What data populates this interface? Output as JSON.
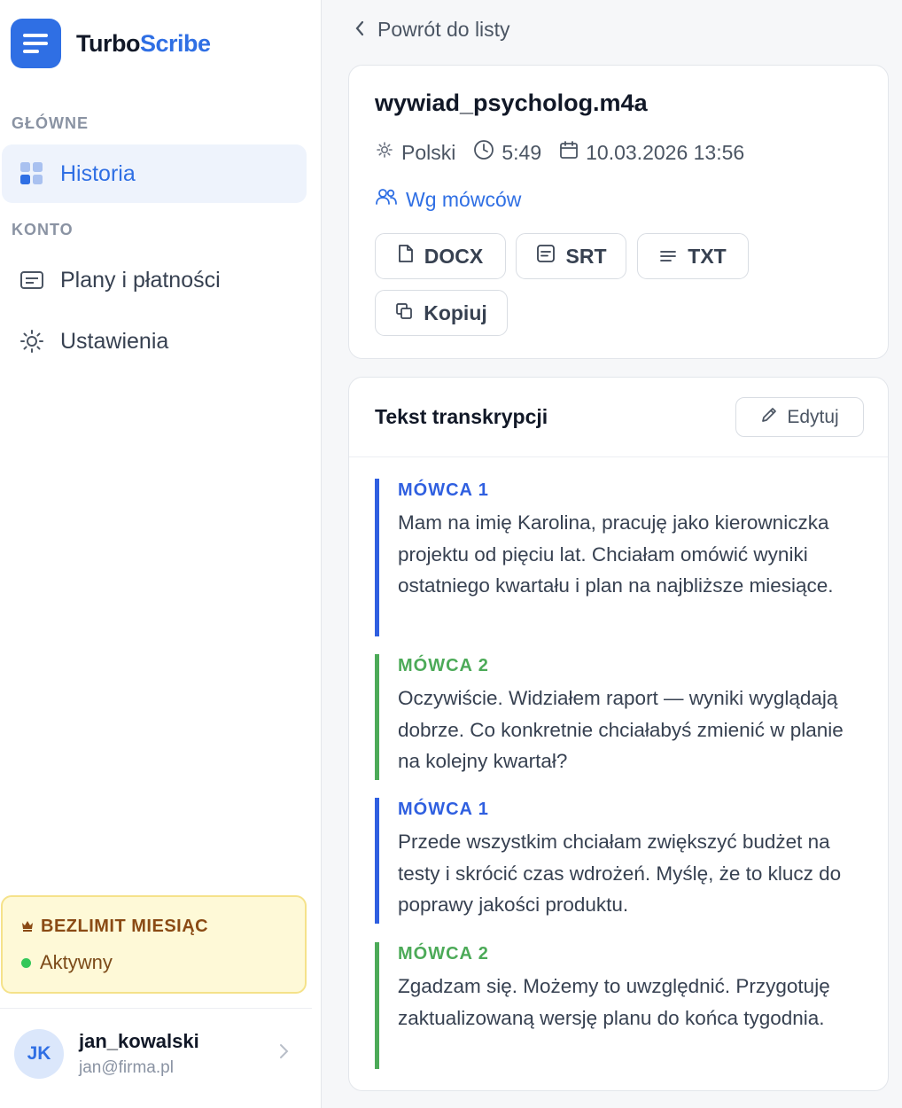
{
  "brand": {
    "name_part1": "Turbo",
    "name_part2": "Scribe"
  },
  "sidebar": {
    "section_main": "GŁÓWNE",
    "section_account": "KONTO",
    "items": [
      {
        "label": "Historia",
        "icon": "grid-icon",
        "active": true
      },
      {
        "label": "Plany i płatności",
        "icon": "card-icon",
        "active": false
      },
      {
        "label": "Ustawienia",
        "icon": "sun-gear-icon",
        "active": false
      }
    ]
  },
  "plan": {
    "name": "BEZLIMIT MIESIĄC",
    "status": "Aktywny",
    "icon": "crown-icon"
  },
  "user": {
    "initials": "JK",
    "username": "jan_kowalski",
    "email": "jan@firma.pl"
  },
  "main": {
    "back_label": "Powrót do listy",
    "file": {
      "name": "wywiad_psycholog.m4a",
      "language": "Polski",
      "duration": "5:49",
      "date": "10.03.2026 13:56",
      "speakers_link": "Wg mówców",
      "buttons": {
        "docx": "DOCX",
        "srt": "SRT",
        "txt": "TXT",
        "copy": "Kopiuj"
      }
    },
    "transcript": {
      "title": "Tekst transkrypcji",
      "edit_label": "Edytuj",
      "segments": [
        {
          "speaker": "MÓWCA 1",
          "text": "Mam na imię Karolina, pracuję jako kierowniczka projektu od pięciu lat. Chciałam omówić wyniki ostatniego kwartału i plan na najbliższe miesiące."
        },
        {
          "speaker": "MÓWCA 2",
          "text": "Oczywiście. Widziałem raport — wyniki wyglądają dobrze. Co konkretnie chciałabyś zmienić w planie na kolejny kwartał?"
        },
        {
          "speaker": "MÓWCA 1",
          "text": "Przede wszystkim chciałam zwiększyć budżet na testy i skrócić czas wdrożeń. Myślę, że to klucz do poprawy jakości produktu."
        },
        {
          "speaker": "MÓWCA 2",
          "text": "Zgadzam się. Możemy to uwzględnić. Przygotuję zaktualizowaną wersję planu do końca tygodnia."
        }
      ]
    }
  },
  "colors": {
    "accent": "#2f6fe4",
    "speaker1": "#2f5fe0",
    "speaker2": "#4caa58",
    "plan_bg": "#fef9d7"
  }
}
